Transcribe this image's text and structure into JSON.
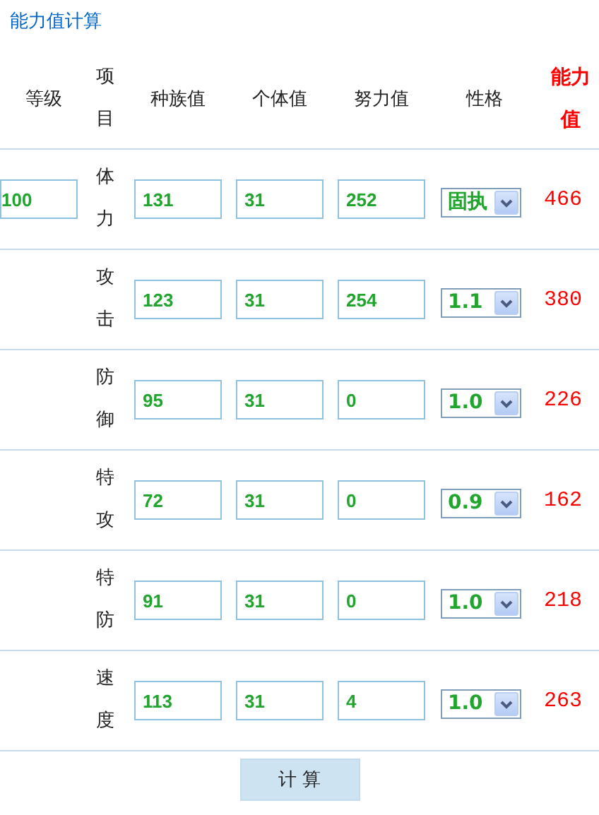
{
  "title": "能力值计算",
  "columns": [
    "等级",
    "项目",
    "种族值",
    "个体值",
    "努力值",
    "性格",
    "能力值"
  ],
  "level": "100",
  "rows": [
    {
      "stat": "体力",
      "base": "131",
      "iv": "31",
      "ev": "252",
      "nature": "固执",
      "result": "466"
    },
    {
      "stat": "攻击",
      "base": "123",
      "iv": "31",
      "ev": "254",
      "nature": "1.1",
      "result": "380"
    },
    {
      "stat": "防御",
      "base": "95",
      "iv": "31",
      "ev": "0",
      "nature": "1.0",
      "result": "226"
    },
    {
      "stat": "特攻",
      "base": "72",
      "iv": "31",
      "ev": "0",
      "nature": "0.9",
      "result": "162"
    },
    {
      "stat": "特防",
      "base": "91",
      "iv": "31",
      "ev": "0",
      "nature": "1.0",
      "result": "218"
    },
    {
      "stat": "速度",
      "base": "113",
      "iv": "31",
      "ev": "4",
      "nature": "1.0",
      "result": "263"
    }
  ],
  "button": "计 算"
}
